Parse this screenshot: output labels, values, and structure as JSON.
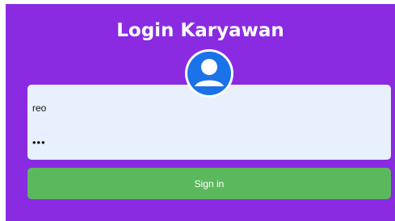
{
  "login": {
    "title": "Login Karyawan",
    "avatar_icon": "user-avatar-icon",
    "username_value": "reo",
    "password_value": "•••",
    "signin_label": "Sign in"
  },
  "colors": {
    "panel_background": "#8a2be2",
    "form_background": "#e8f0fe",
    "button_background": "#5cb85c",
    "avatar_blue": "#1a73e8"
  }
}
